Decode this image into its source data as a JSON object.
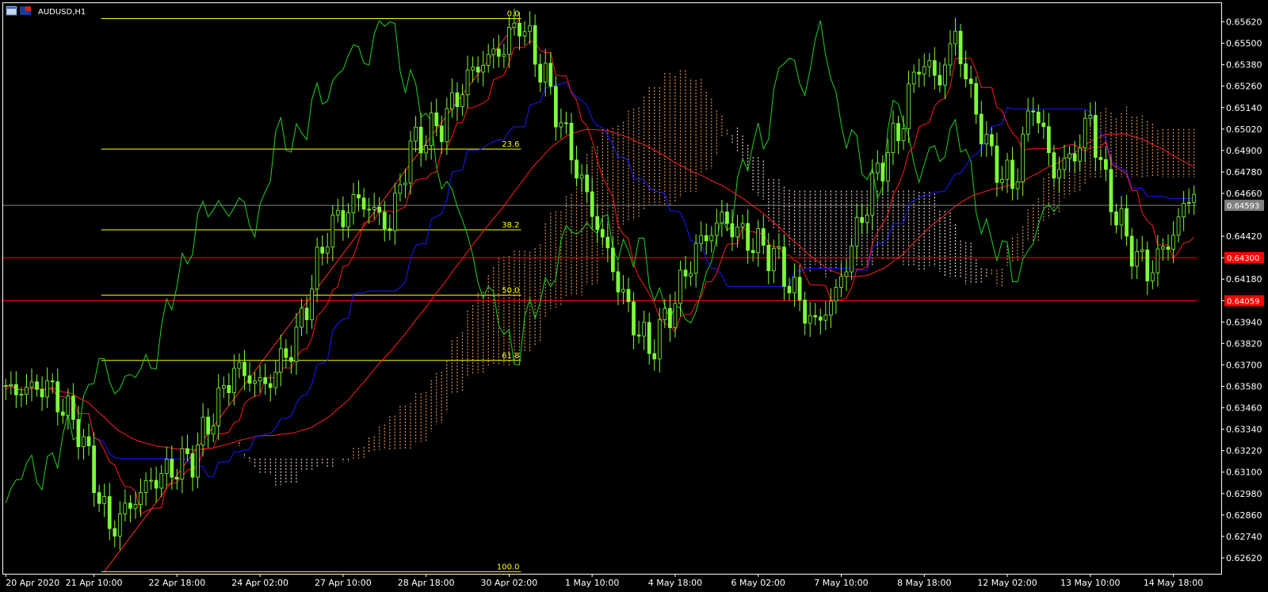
{
  "window": {
    "symbol_label": "AUDUSD,H1"
  },
  "colors": {
    "background": "#000000",
    "frame": "#ffffff",
    "candle": "#7dff3a",
    "chikou": "#1fd21f",
    "tenkan": "#ff1a1a",
    "kijun": "#1a1aff",
    "ma_slow": "#ff2020",
    "cloud_up": "#f4a460",
    "cloud_down": "#ffe4e1",
    "fib": "#ffff00",
    "price_line": "#808080",
    "hline": "#ff0000"
  },
  "current_price_tag": "0.64593",
  "horizontal_levels": [
    {
      "tag": "0.64300",
      "value": 0.643
    },
    {
      "tag": "0.64059",
      "value": 0.64059
    }
  ],
  "fibonacci": {
    "high": 0.65638,
    "low": 0.62543,
    "start_index": 19,
    "end_index": 99,
    "labels": [
      "0.0",
      "23.6",
      "38.2",
      "50.0",
      "61.8",
      "100.0"
    ],
    "levels": [
      0,
      23.6,
      38.2,
      50.0,
      61.8,
      100.0
    ]
  },
  "chart_data": {
    "type": "candlestick",
    "title": "AUDUSD,H1",
    "xlabel": "",
    "ylabel": "",
    "ylim": [
      0.6254,
      0.6572
    ],
    "y_ticks": [
      "0.65620",
      "0.65500",
      "0.65380",
      "0.65260",
      "0.65140",
      "0.65020",
      "0.64900",
      "0.64780",
      "0.64660",
      "0.64420",
      "0.64300",
      "0.64180",
      "0.64060",
      "0.63940",
      "0.63820",
      "0.63700",
      "0.63580",
      "0.63460",
      "0.63340",
      "0.63220",
      "0.63100",
      "0.62980",
      "0.62860",
      "0.62740",
      "0.62620"
    ],
    "x_ticks": [
      "20 Apr 2020",
      "21 Apr 10:00",
      "22 Apr 18:00",
      "24 Apr 02:00",
      "27 Apr 10:00",
      "28 Apr 18:00",
      "30 Apr 02:00",
      "1 May 10:00",
      "4 May 18:00",
      "6 May 02:00",
      "7 May 10:00",
      "8 May 18:00",
      "12 May 02:00",
      "13 May 10:00",
      "14 May 18:00"
    ],
    "x_tick_index": [
      0,
      17,
      33,
      49,
      65,
      81,
      97,
      113,
      129,
      145,
      161,
      177,
      193,
      209,
      225
    ],
    "bar_count": 230,
    "close_anchors": [
      [
        0,
        0.6355
      ],
      [
        8,
        0.6358
      ],
      [
        14,
        0.6335
      ],
      [
        20,
        0.6278
      ],
      [
        28,
        0.6305
      ],
      [
        36,
        0.6318
      ],
      [
        44,
        0.6368
      ],
      [
        50,
        0.6358
      ],
      [
        56,
        0.6385
      ],
      [
        62,
        0.6445
      ],
      [
        68,
        0.6463
      ],
      [
        74,
        0.6448
      ],
      [
        78,
        0.6492
      ],
      [
        84,
        0.6505
      ],
      [
        90,
        0.6535
      ],
      [
        96,
        0.6548
      ],
      [
        99,
        0.6563
      ],
      [
        104,
        0.653
      ],
      [
        110,
        0.648
      ],
      [
        116,
        0.6432
      ],
      [
        120,
        0.64
      ],
      [
        124,
        0.6378
      ],
      [
        128,
        0.64
      ],
      [
        133,
        0.6435
      ],
      [
        138,
        0.6452
      ],
      [
        143,
        0.644
      ],
      [
        148,
        0.6432
      ],
      [
        153,
        0.6405
      ],
      [
        156,
        0.6392
      ],
      [
        160,
        0.641
      ],
      [
        164,
        0.6445
      ],
      [
        168,
        0.6478
      ],
      [
        172,
        0.65
      ],
      [
        176,
        0.654
      ],
      [
        180,
        0.653
      ],
      [
        183,
        0.6555
      ],
      [
        186,
        0.652
      ],
      [
        190,
        0.6485
      ],
      [
        194,
        0.647
      ],
      [
        198,
        0.6518
      ],
      [
        202,
        0.6478
      ],
      [
        206,
        0.6488
      ],
      [
        209,
        0.6508
      ],
      [
        212,
        0.647
      ],
      [
        216,
        0.644
      ],
      [
        220,
        0.6422
      ],
      [
        224,
        0.6438
      ],
      [
        229,
        0.647
      ]
    ],
    "series": [
      {
        "type": "candlestick"
      },
      {
        "type": "line",
        "role": "tenkan-sen"
      },
      {
        "type": "line",
        "role": "kijun-sen"
      },
      {
        "type": "line",
        "role": "chikou-span"
      },
      {
        "type": "line",
        "role": "moving-average"
      },
      {
        "type": "area",
        "role": "kumo-cloud"
      }
    ],
    "grid": false,
    "legend": "none"
  }
}
